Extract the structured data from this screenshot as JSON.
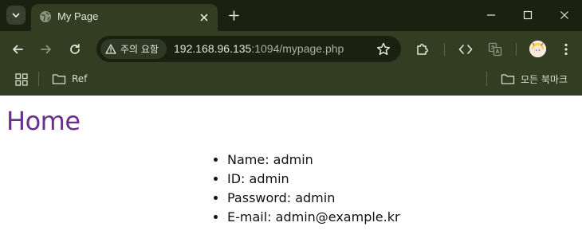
{
  "browser": {
    "tab": {
      "title": "My Page"
    },
    "address_bar": {
      "security_label": "주의 요함",
      "url_host": "192.168.96.135",
      "url_path": ":1094/mypage.php"
    },
    "bookmarks": {
      "left_folder": "Ref",
      "right_folder": "모든 북마크"
    },
    "colors": {
      "frame": "#1b2010",
      "toolbar": "#333d22",
      "heading": "#6a2e8e"
    }
  },
  "page": {
    "title": "Home",
    "items": [
      {
        "text": "Name: admin"
      },
      {
        "text": "ID: admin"
      },
      {
        "text": "Password: admin"
      },
      {
        "text": "E-mail: admin@example.kr"
      }
    ]
  }
}
